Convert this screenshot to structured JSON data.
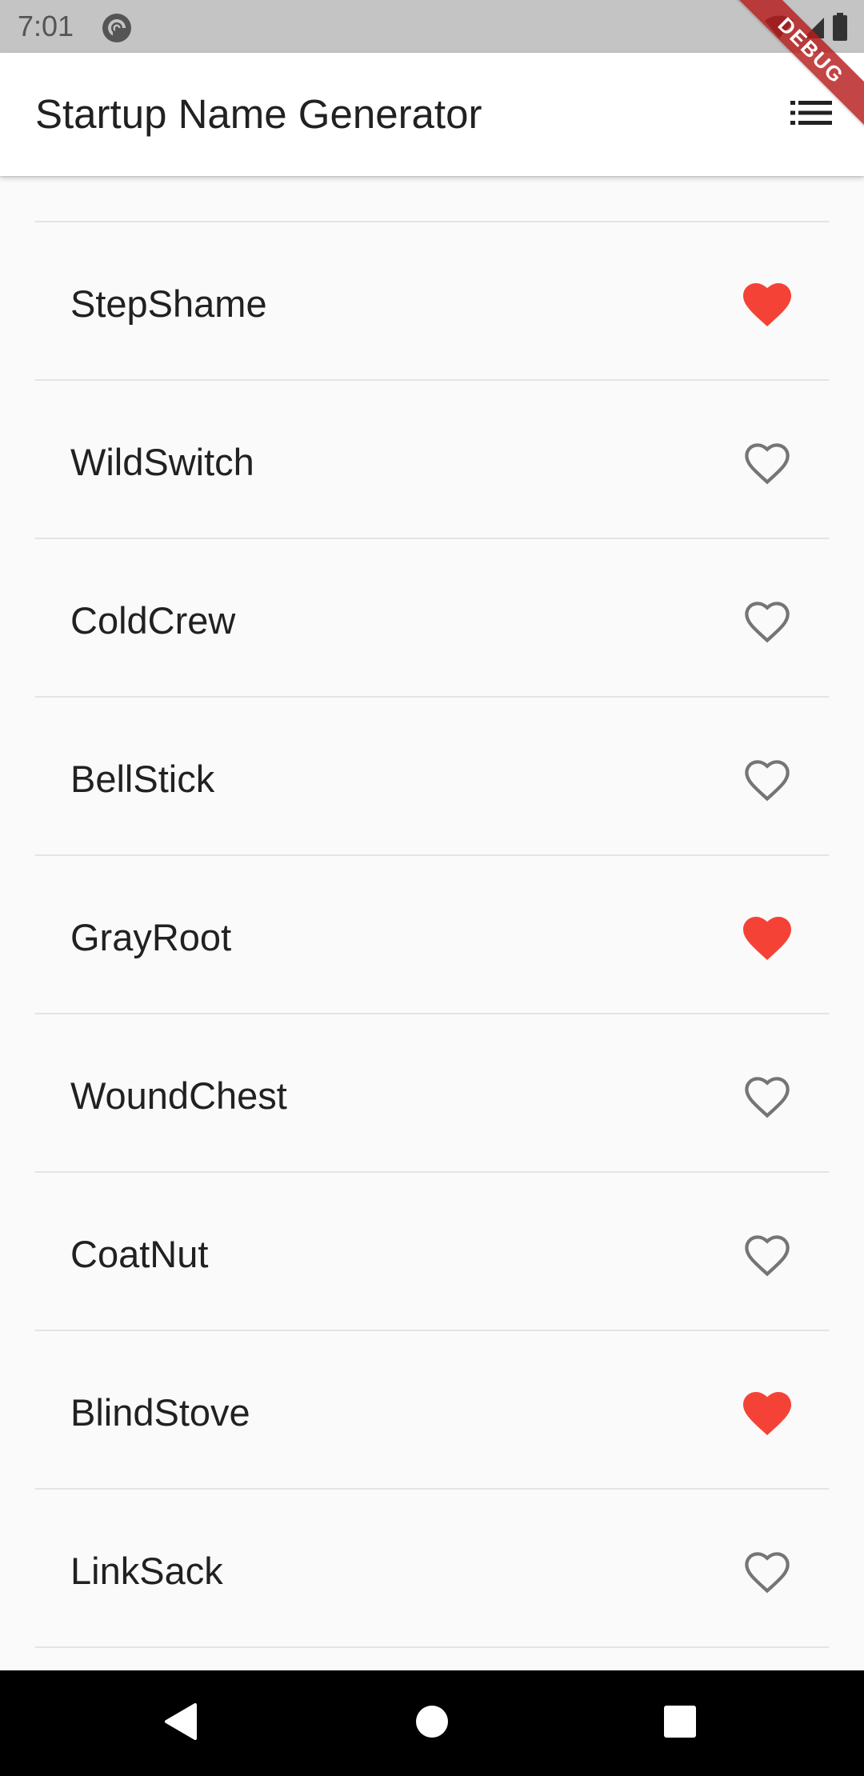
{
  "status_bar": {
    "time": "7:01",
    "app_icon": "pocket-casts-icon",
    "wifi_icon": "wifi-icon",
    "signal_icon": "cell-signal-icon",
    "battery_icon": "battery-icon"
  },
  "debug_banner": "DEBUG",
  "app_bar": {
    "title": "Startup Name Generator",
    "action_icon": "list-icon"
  },
  "colors": {
    "favorite": "#f44336",
    "not_favorite": "#757575",
    "app_bar_bg": "#ffffff",
    "list_bg": "#fafafa"
  },
  "names": [
    {
      "name": "StepShame",
      "saved": true
    },
    {
      "name": "WildSwitch",
      "saved": false
    },
    {
      "name": "ColdCrew",
      "saved": false
    },
    {
      "name": "BellStick",
      "saved": false
    },
    {
      "name": "GrayRoot",
      "saved": true
    },
    {
      "name": "WoundChest",
      "saved": false
    },
    {
      "name": "CoatNut",
      "saved": false
    },
    {
      "name": "BlindStove",
      "saved": true
    },
    {
      "name": "LinkSack",
      "saved": false
    }
  ],
  "nav_bar": {
    "back_icon": "back-triangle-icon",
    "home_icon": "home-circle-icon",
    "recents_icon": "recents-square-icon"
  }
}
